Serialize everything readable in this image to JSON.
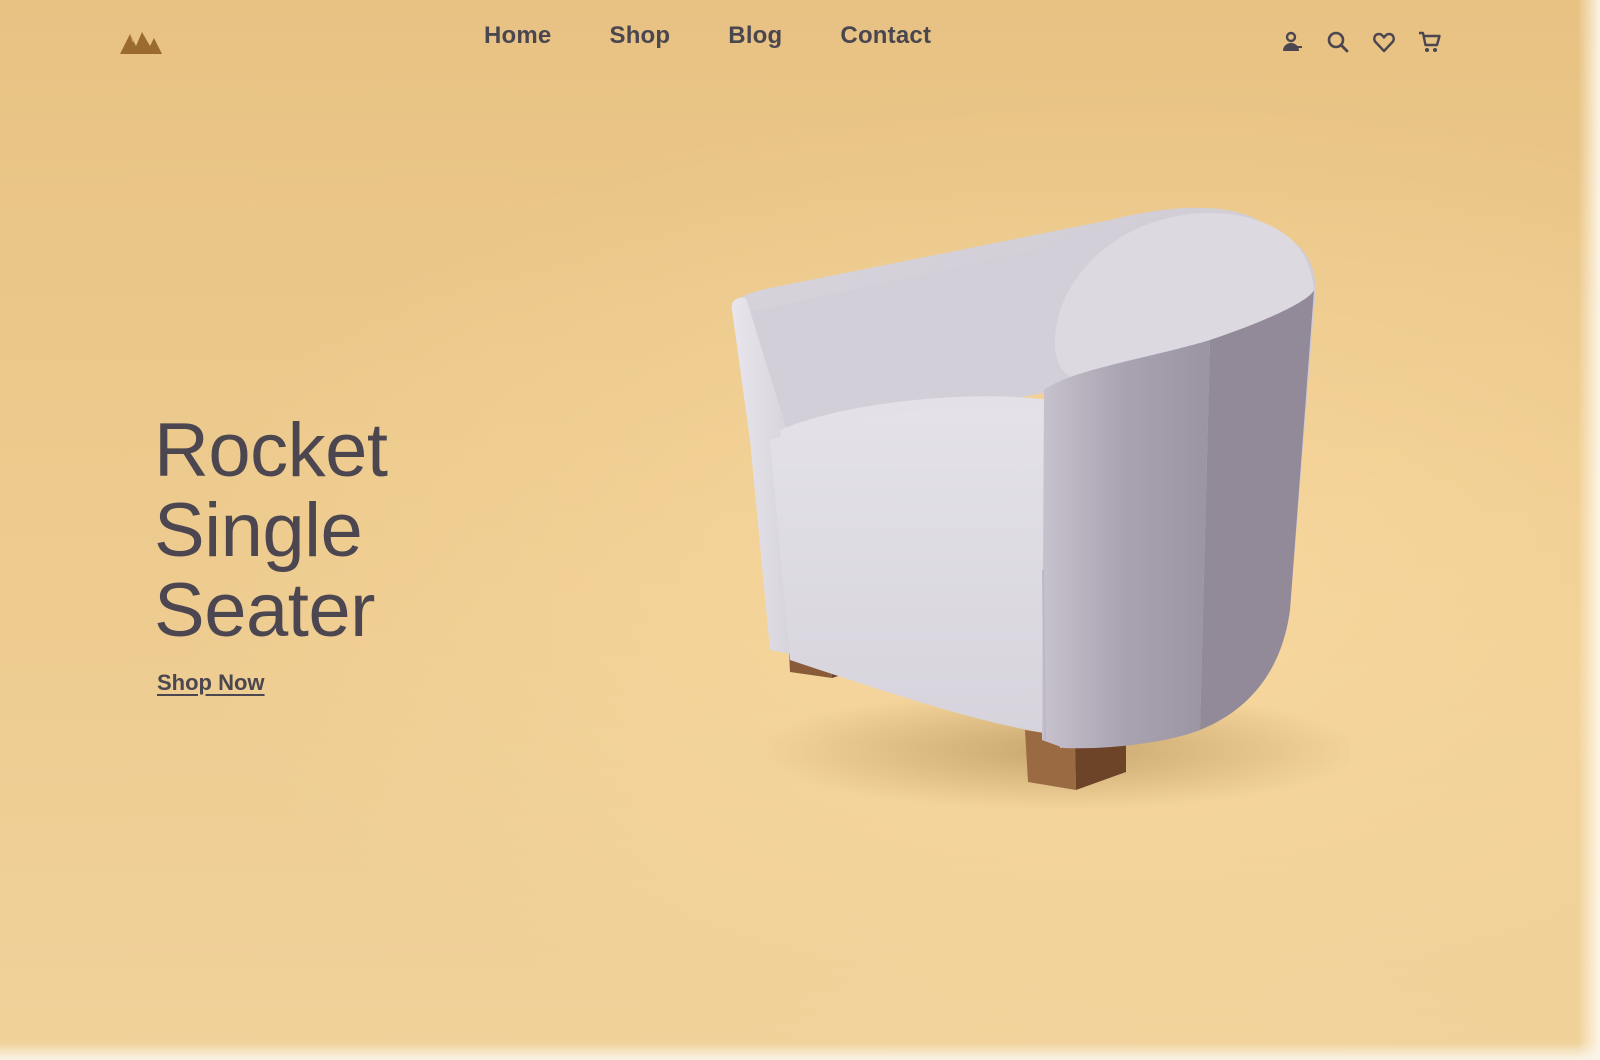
{
  "header": {
    "logo_icon": "mountain-logo-icon",
    "nav": [
      {
        "label": "Home"
      },
      {
        "label": "Shop"
      },
      {
        "label": "Blog"
      },
      {
        "label": "Contact"
      }
    ],
    "icons": [
      "account-icon",
      "search-icon",
      "heart-icon",
      "cart-icon"
    ]
  },
  "hero": {
    "title_lines": [
      "Rocket",
      "Single",
      "Seater"
    ],
    "cta_label": "Shop Now",
    "image": "armchair-image"
  },
  "colors": {
    "background": "#ecc98a",
    "text": "#4b4650",
    "brand": "#9a6a2e"
  }
}
